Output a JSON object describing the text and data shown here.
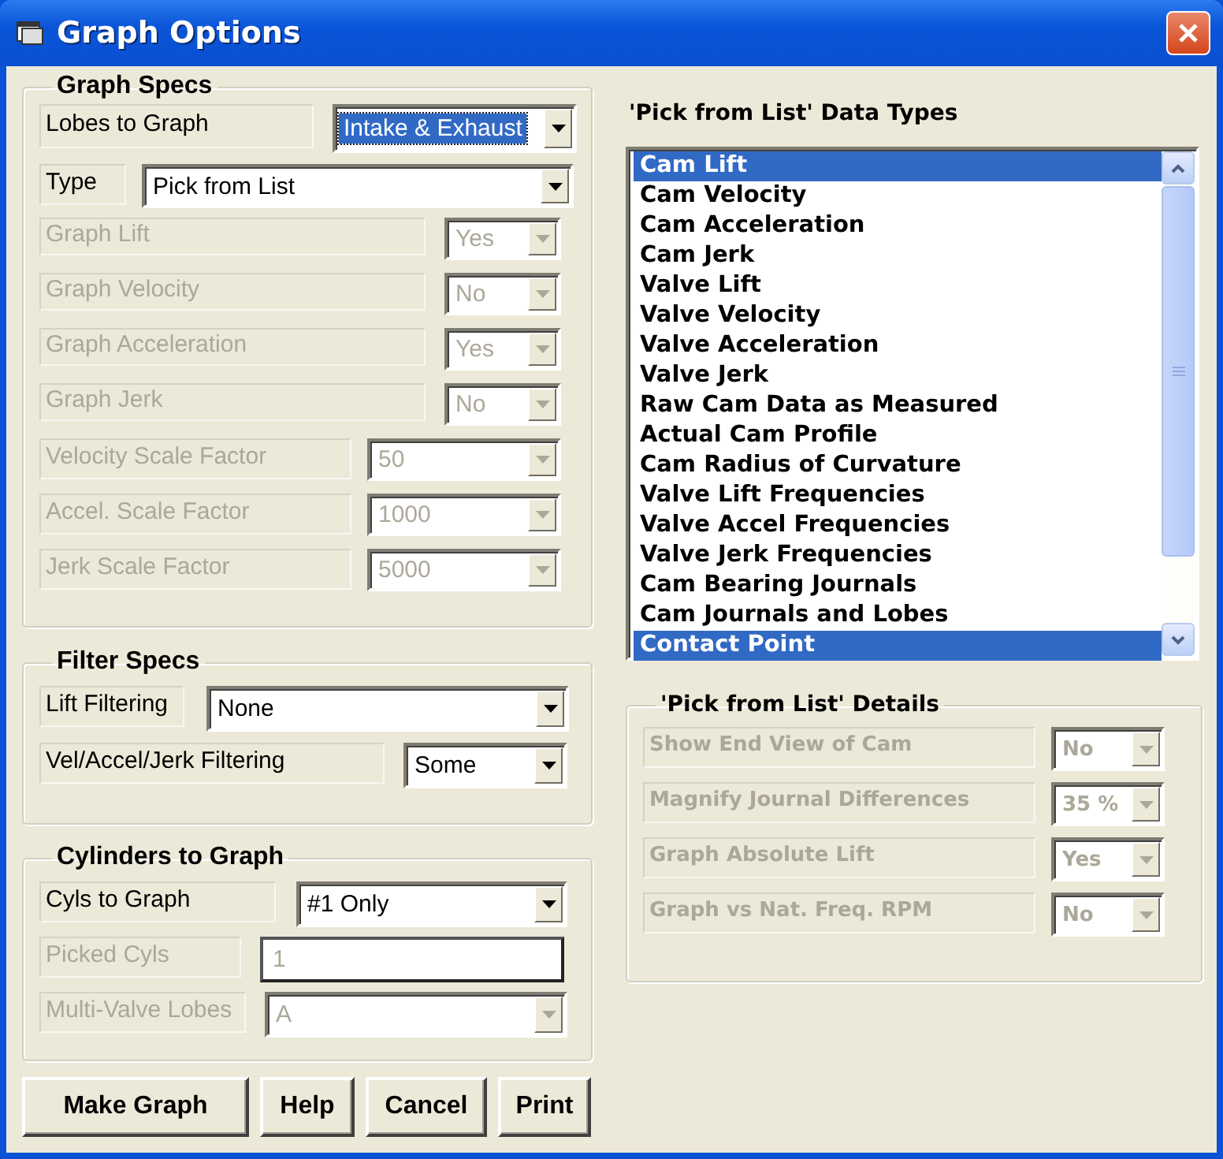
{
  "window": {
    "title": "Graph Options"
  },
  "graph_specs": {
    "title": "Graph Specs",
    "rows": [
      {
        "label": "Lobes to Graph",
        "kind": "combo",
        "value": "Intake & Exhaust",
        "disabled": false,
        "focused": true
      },
      {
        "label": "Type",
        "kind": "combo",
        "value": "Pick from List",
        "disabled": false,
        "focused": false
      },
      {
        "label": "Graph Lift",
        "kind": "combo",
        "value": "Yes",
        "disabled": true,
        "focused": false
      },
      {
        "label": "Graph Velocity",
        "kind": "combo",
        "value": "No",
        "disabled": true,
        "focused": false
      },
      {
        "label": "Graph Acceleration",
        "kind": "combo",
        "value": "Yes",
        "disabled": true,
        "focused": false
      },
      {
        "label": "Graph Jerk",
        "kind": "combo",
        "value": "No",
        "disabled": true,
        "focused": false
      },
      {
        "label": "Velocity Scale Factor",
        "kind": "combo",
        "value": "50",
        "disabled": true,
        "focused": false
      },
      {
        "label": "Accel. Scale Factor",
        "kind": "combo",
        "value": "1000",
        "disabled": true,
        "focused": false
      },
      {
        "label": "Jerk Scale Factor",
        "kind": "combo",
        "value": "5000",
        "disabled": true,
        "focused": false
      }
    ]
  },
  "filter_specs": {
    "title": "Filter Specs",
    "rows": [
      {
        "label": "Lift Filtering",
        "kind": "combo",
        "value": "None",
        "disabled": false,
        "focused": false
      },
      {
        "label": "Vel/Accel/Jerk Filtering",
        "kind": "combo",
        "value": "Some",
        "disabled": false,
        "focused": false
      }
    ]
  },
  "cylinders": {
    "title": "Cylinders to Graph",
    "rows": [
      {
        "label": "Cyls to Graph",
        "kind": "combo",
        "value": "#1 Only",
        "disabled": false,
        "focused": false
      },
      {
        "label": "Picked Cyls",
        "kind": "input",
        "value": "1",
        "disabled": true,
        "focused": false
      },
      {
        "label": "Multi-Valve Lobes",
        "kind": "combo",
        "value": "A",
        "disabled": true,
        "focused": false
      }
    ]
  },
  "buttons": [
    "Make Graph",
    "Help",
    "Cancel",
    "Print"
  ],
  "data_types": {
    "title": "'Pick from List' Data Types",
    "items": [
      {
        "label": "Cam Lift",
        "selected": true
      },
      {
        "label": "Cam Velocity",
        "selected": false
      },
      {
        "label": "Cam Acceleration",
        "selected": false
      },
      {
        "label": "Cam Jerk",
        "selected": false
      },
      {
        "label": "Valve Lift",
        "selected": false
      },
      {
        "label": "Valve Velocity",
        "selected": false
      },
      {
        "label": "Valve Acceleration",
        "selected": false
      },
      {
        "label": "Valve Jerk",
        "selected": false
      },
      {
        "label": "Raw Cam Data as Measured",
        "selected": false
      },
      {
        "label": "Actual Cam Profile",
        "selected": false
      },
      {
        "label": "Cam Radius of Curvature",
        "selected": false
      },
      {
        "label": "Valve Lift Frequencies",
        "selected": false
      },
      {
        "label": "Valve Accel Frequencies",
        "selected": false
      },
      {
        "label": "Valve Jerk Frequencies",
        "selected": false
      },
      {
        "label": "Cam Bearing Journals",
        "selected": false
      },
      {
        "label": "Cam Journals and Lobes",
        "selected": false
      },
      {
        "label": "Contact Point",
        "selected": true
      }
    ]
  },
  "details": {
    "title": "'Pick from List' Details",
    "rows": [
      {
        "label": "Show End View of Cam",
        "kind": "combo",
        "value": "No",
        "disabled": true,
        "focused": false
      },
      {
        "label": "Magnify Journal Differences",
        "kind": "combo",
        "value": "35 %",
        "disabled": true,
        "focused": false
      },
      {
        "label": "Graph Absolute Lift",
        "kind": "combo",
        "value": "Yes",
        "disabled": true,
        "focused": false
      },
      {
        "label": "Graph vs Nat. Freq. RPM",
        "kind": "combo",
        "value": "No",
        "disabled": true,
        "focused": false
      }
    ]
  }
}
